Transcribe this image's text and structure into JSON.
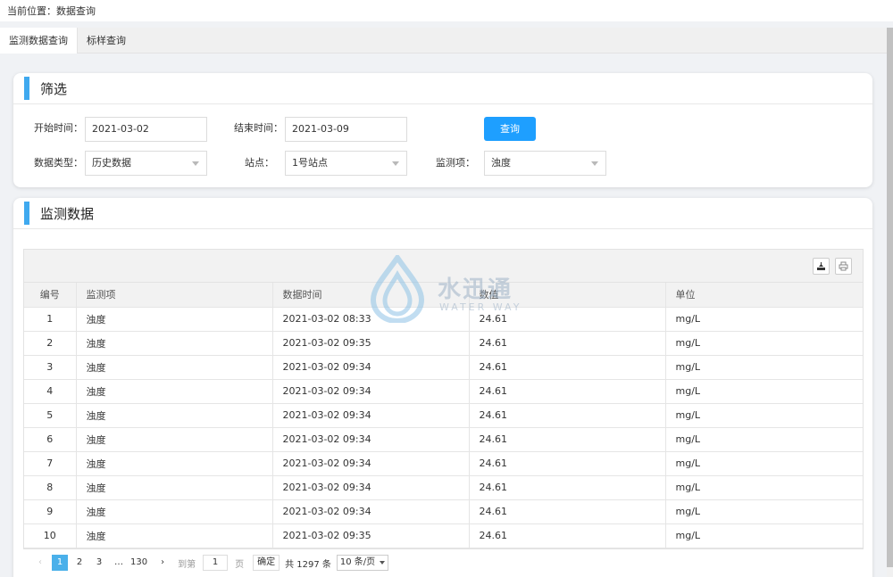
{
  "breadcrumb": "当前位置：数据查询",
  "tabs": [
    {
      "label": "监测数据查询",
      "active": true
    },
    {
      "label": "标样查询",
      "active": false
    }
  ],
  "filter": {
    "title": "筛选",
    "start_label": "开始时间：",
    "start_value": "2021-03-02",
    "end_label": "结束时间：",
    "end_value": "2021-03-09",
    "query_button": "查询",
    "type_label": "数据类型：",
    "type_value": "历史数据",
    "station_label": "站点：",
    "station_value": "1号站点",
    "item_label": "监测项：",
    "item_value": "浊度"
  },
  "data_section": {
    "title": "监测数据",
    "columns": [
      "编号",
      "监测项",
      "数据时间",
      "数值",
      "单位"
    ],
    "rows": [
      [
        "1",
        "浊度",
        "2021-03-02 08:33",
        "24.61",
        "mg/L"
      ],
      [
        "2",
        "浊度",
        "2021-03-02 09:35",
        "24.61",
        "mg/L"
      ],
      [
        "3",
        "浊度",
        "2021-03-02 09:34",
        "24.61",
        "mg/L"
      ],
      [
        "4",
        "浊度",
        "2021-03-02 09:34",
        "24.61",
        "mg/L"
      ],
      [
        "5",
        "浊度",
        "2021-03-02 09:34",
        "24.61",
        "mg/L"
      ],
      [
        "6",
        "浊度",
        "2021-03-02 09:34",
        "24.61",
        "mg/L"
      ],
      [
        "7",
        "浊度",
        "2021-03-02 09:34",
        "24.61",
        "mg/L"
      ],
      [
        "8",
        "浊度",
        "2021-03-02 09:34",
        "24.61",
        "mg/L"
      ],
      [
        "9",
        "浊度",
        "2021-03-02 09:34",
        "24.61",
        "mg/L"
      ],
      [
        "10",
        "浊度",
        "2021-03-02 09:35",
        "24.61",
        "mg/L"
      ]
    ]
  },
  "pager": {
    "prev": "‹",
    "pages": [
      "1",
      "2",
      "3"
    ],
    "ellipsis": "…",
    "last": "130",
    "next": "›",
    "goto_label": "到第",
    "goto_value": "1",
    "page_unit": "页",
    "confirm": "确定",
    "total": "共 1297 条",
    "page_size": "10 条/页"
  },
  "watermark": {
    "title": "水迅通",
    "subtitle": "WATER WAY"
  },
  "colors": {
    "accent": "#3fa9ef",
    "button": "#1e9fff",
    "page_current": "#4ab0ea"
  },
  "icons": {
    "export": "export-icon",
    "print": "print-icon"
  }
}
